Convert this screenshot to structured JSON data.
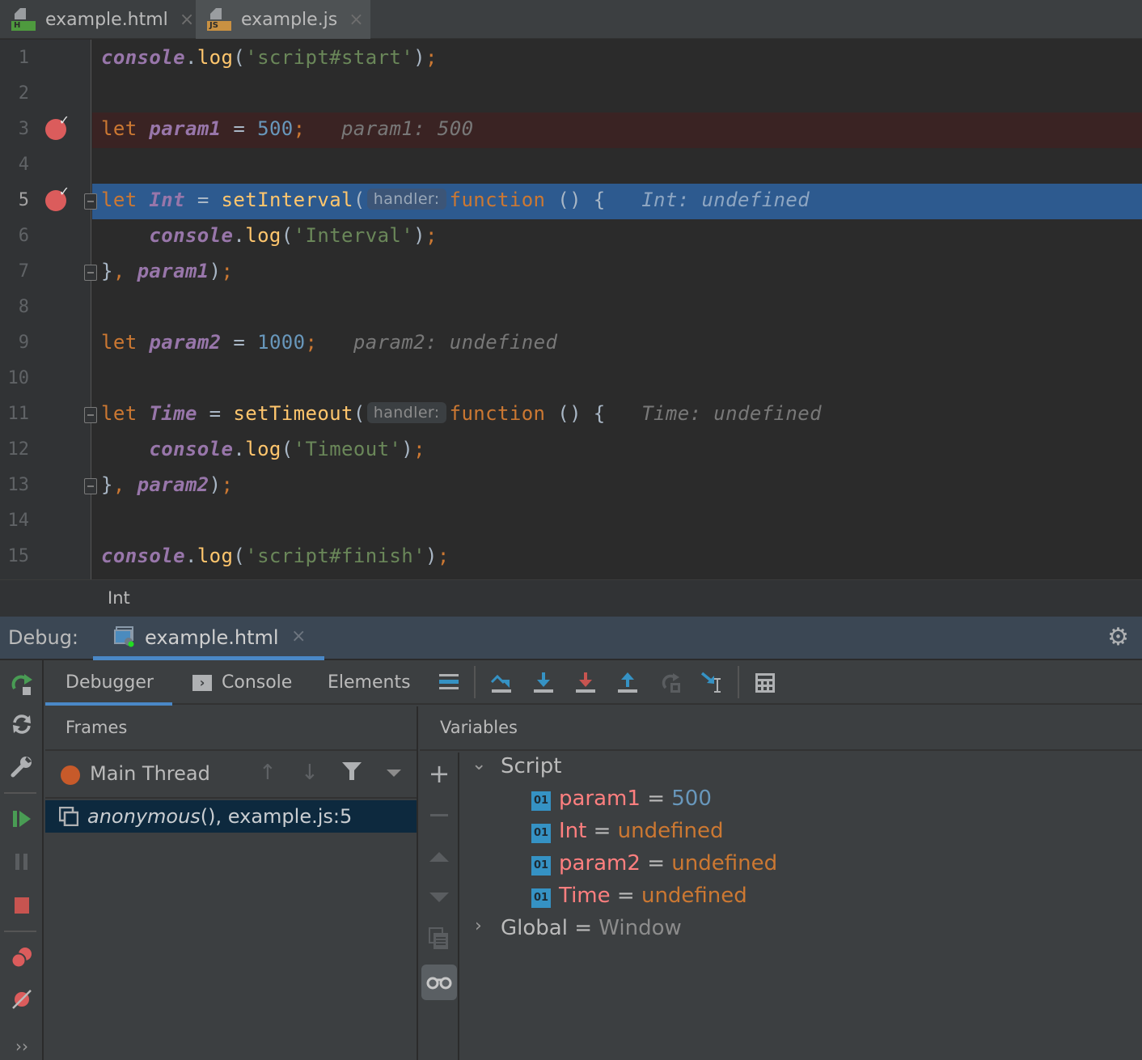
{
  "tabs": [
    {
      "label": "example.html",
      "badge": "H",
      "badge_color": "#4e9a3e",
      "active": false
    },
    {
      "label": "example.js",
      "badge": "JS",
      "badge_color": "#c99142",
      "active": true
    }
  ],
  "editor": {
    "lines": [
      {
        "n": "1"
      },
      {
        "n": "2"
      },
      {
        "n": "3"
      },
      {
        "n": "4"
      },
      {
        "n": "5"
      },
      {
        "n": "6"
      },
      {
        "n": "7"
      },
      {
        "n": "8"
      },
      {
        "n": "9"
      },
      {
        "n": "10"
      },
      {
        "n": "11"
      },
      {
        "n": "12"
      },
      {
        "n": "13"
      },
      {
        "n": "14"
      },
      {
        "n": "15"
      }
    ],
    "code": {
      "l1": {
        "obj": "console",
        "dot": ".",
        "fn": "log",
        "open": "(",
        "str": "'script#start'",
        "close": ")",
        "semi": ";"
      },
      "l3": {
        "kw": "let",
        "var": "param1",
        "eq": " = ",
        "num": "500",
        "semi": ";",
        "inlay": "param1: 500"
      },
      "l5": {
        "kw": "let",
        "var": "Int",
        "eq": " = ",
        "fn": "setInterval",
        "open": "(",
        "hint": "handler:",
        "kw2": "function",
        "rest": " () {",
        "inlay": "Int: undefined"
      },
      "l6": {
        "indent": "    ",
        "obj": "console",
        "dot": ".",
        "fn": "log",
        "open": "(",
        "str": "'Interval'",
        "close": ")",
        "semi": ";"
      },
      "l7": {
        "brace": "}",
        "comma": ", ",
        "var": "param1",
        "close": ")",
        "semi": ";"
      },
      "l9": {
        "kw": "let",
        "var": "param2",
        "eq": " = ",
        "num": "1000",
        "semi": ";",
        "inlay": "param2: undefined"
      },
      "l11": {
        "kw": "let",
        "var": "Time",
        "eq": " = ",
        "fn": "setTimeout",
        "open": "(",
        "hint": "handler:",
        "kw2": "function",
        "rest": " () {",
        "inlay": "Time: undefined"
      },
      "l12": {
        "indent": "    ",
        "obj": "console",
        "dot": ".",
        "fn": "log",
        "open": "(",
        "str": "'Timeout'",
        "close": ")",
        "semi": ";"
      },
      "l13": {
        "brace": "}",
        "comma": ", ",
        "var": "param2",
        "close": ")",
        "semi": ";"
      },
      "l15": {
        "obj": "console",
        "dot": ".",
        "fn": "log",
        "open": "(",
        "str": "'script#finish'",
        "close": ")",
        "semi": ";"
      }
    },
    "breakpoint_lines": [
      3,
      5
    ],
    "execution_line": 5
  },
  "breadcrumb": "Int",
  "debug": {
    "label": "Debug:",
    "session_tab": "example.html",
    "tabs": {
      "debugger": "Debugger",
      "console": "Console",
      "elements": "Elements"
    },
    "frames": {
      "header": "Frames",
      "thread": "Main Thread",
      "frame_fn": "anonymous",
      "frame_rest": "(), example.js:5"
    },
    "variables": {
      "header": "Variables",
      "script_label": "Script",
      "items": [
        {
          "name": "param1",
          "eq": " = ",
          "value": "500",
          "type": "number"
        },
        {
          "name": "Int",
          "eq": " = ",
          "value": "undefined",
          "type": "undefined"
        },
        {
          "name": "param2",
          "eq": " = ",
          "value": "undefined",
          "type": "undefined"
        },
        {
          "name": "Time",
          "eq": " = ",
          "value": "undefined",
          "type": "undefined"
        }
      ],
      "global_label": "Global",
      "global_eq": " = ",
      "global_value": "Window",
      "badge": "01"
    }
  },
  "colors": {
    "accent": "#4a88c7",
    "execution_line": "#2d5a8f",
    "breakpoint": "#db5c5c",
    "thread_dot": "#c75a2a"
  }
}
